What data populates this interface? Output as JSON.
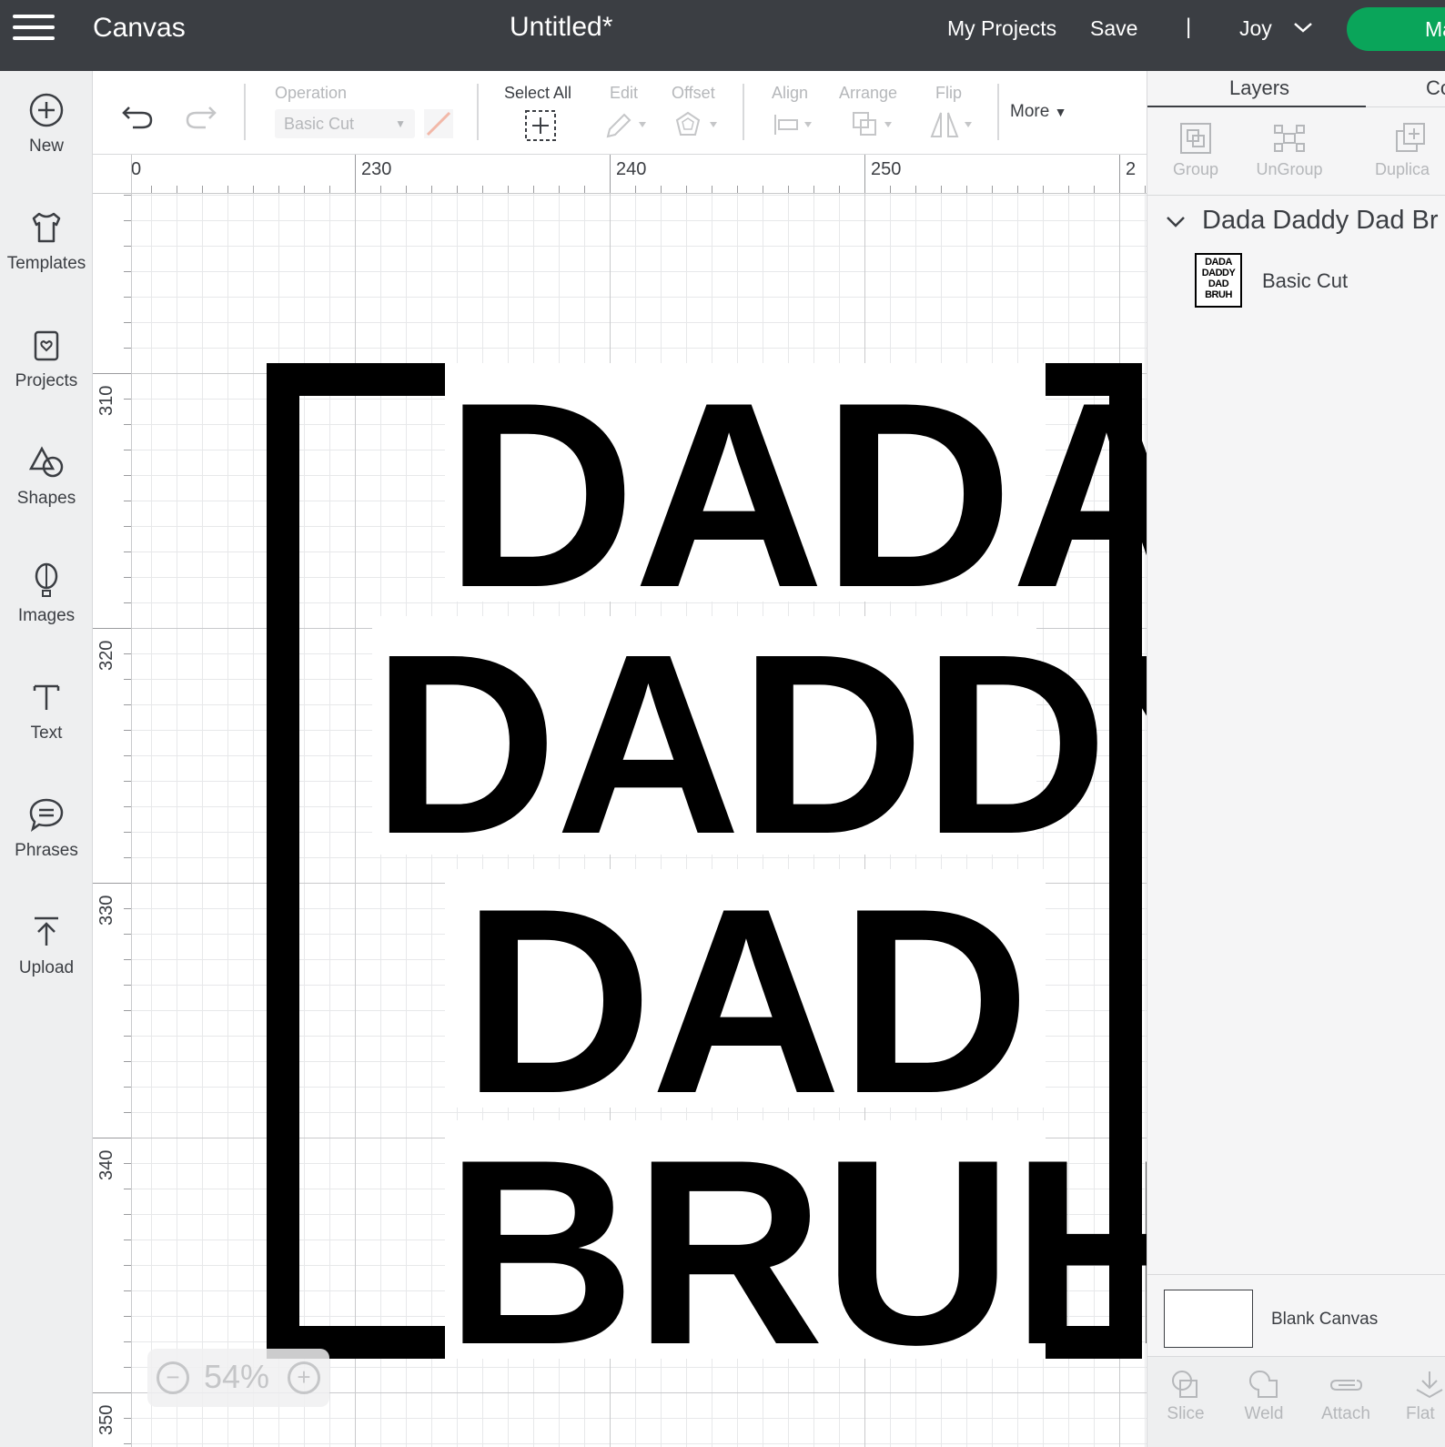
{
  "header": {
    "app_name": "Canvas",
    "doc_title": "Untitled*",
    "my_projects": "My Projects",
    "save": "Save",
    "separator": "|",
    "user": "Joy",
    "make_label": "Ma"
  },
  "sidebar": {
    "items": [
      {
        "label": "New",
        "icon": "plus-circle-icon"
      },
      {
        "label": "Templates",
        "icon": "shirt-icon"
      },
      {
        "label": "Projects",
        "icon": "projects-icon"
      },
      {
        "label": "Shapes",
        "icon": "shapes-icon"
      },
      {
        "label": "Images",
        "icon": "balloon-icon"
      },
      {
        "label": "Text",
        "icon": "text-icon"
      },
      {
        "label": "Phrases",
        "icon": "speech-bubble-icon"
      },
      {
        "label": "Upload",
        "icon": "upload-icon"
      }
    ]
  },
  "toolbar": {
    "operation_label": "Operation",
    "operation_value": "Basic Cut",
    "select_all": "Select All",
    "edit": "Edit",
    "offset": "Offset",
    "align": "Align",
    "arrange": "Arrange",
    "flip": "Flip",
    "more": "More"
  },
  "rulers": {
    "top": [
      "0",
      "230",
      "240",
      "250",
      "2"
    ],
    "left": [
      "310",
      "320",
      "330",
      "340",
      "350"
    ]
  },
  "design": {
    "lines": [
      "DADA",
      "DADDY",
      "DAD",
      "BRUH"
    ]
  },
  "zoom": {
    "value": "54%",
    "minus": "−",
    "plus": "+"
  },
  "right_panel": {
    "tabs": [
      "Layers",
      "Co"
    ],
    "tools": [
      "Group",
      "UnGroup",
      "Duplica"
    ],
    "layer_group_name": "Dada Daddy Dad Br",
    "layer_thumb_lines": [
      "DADA",
      "DADDY",
      "DAD",
      "BRUH"
    ],
    "layer_item_label": "Basic Cut",
    "blank_canvas_label": "Blank Canvas",
    "bottom_tools": [
      "Slice",
      "Weld",
      "Attach",
      "Flat"
    ]
  },
  "colors": {
    "header_bg": "#3b3e43",
    "make_button": "#0aa55a",
    "sidebar_bg": "#eeeff0",
    "panel_bg": "#f5f5f6"
  }
}
